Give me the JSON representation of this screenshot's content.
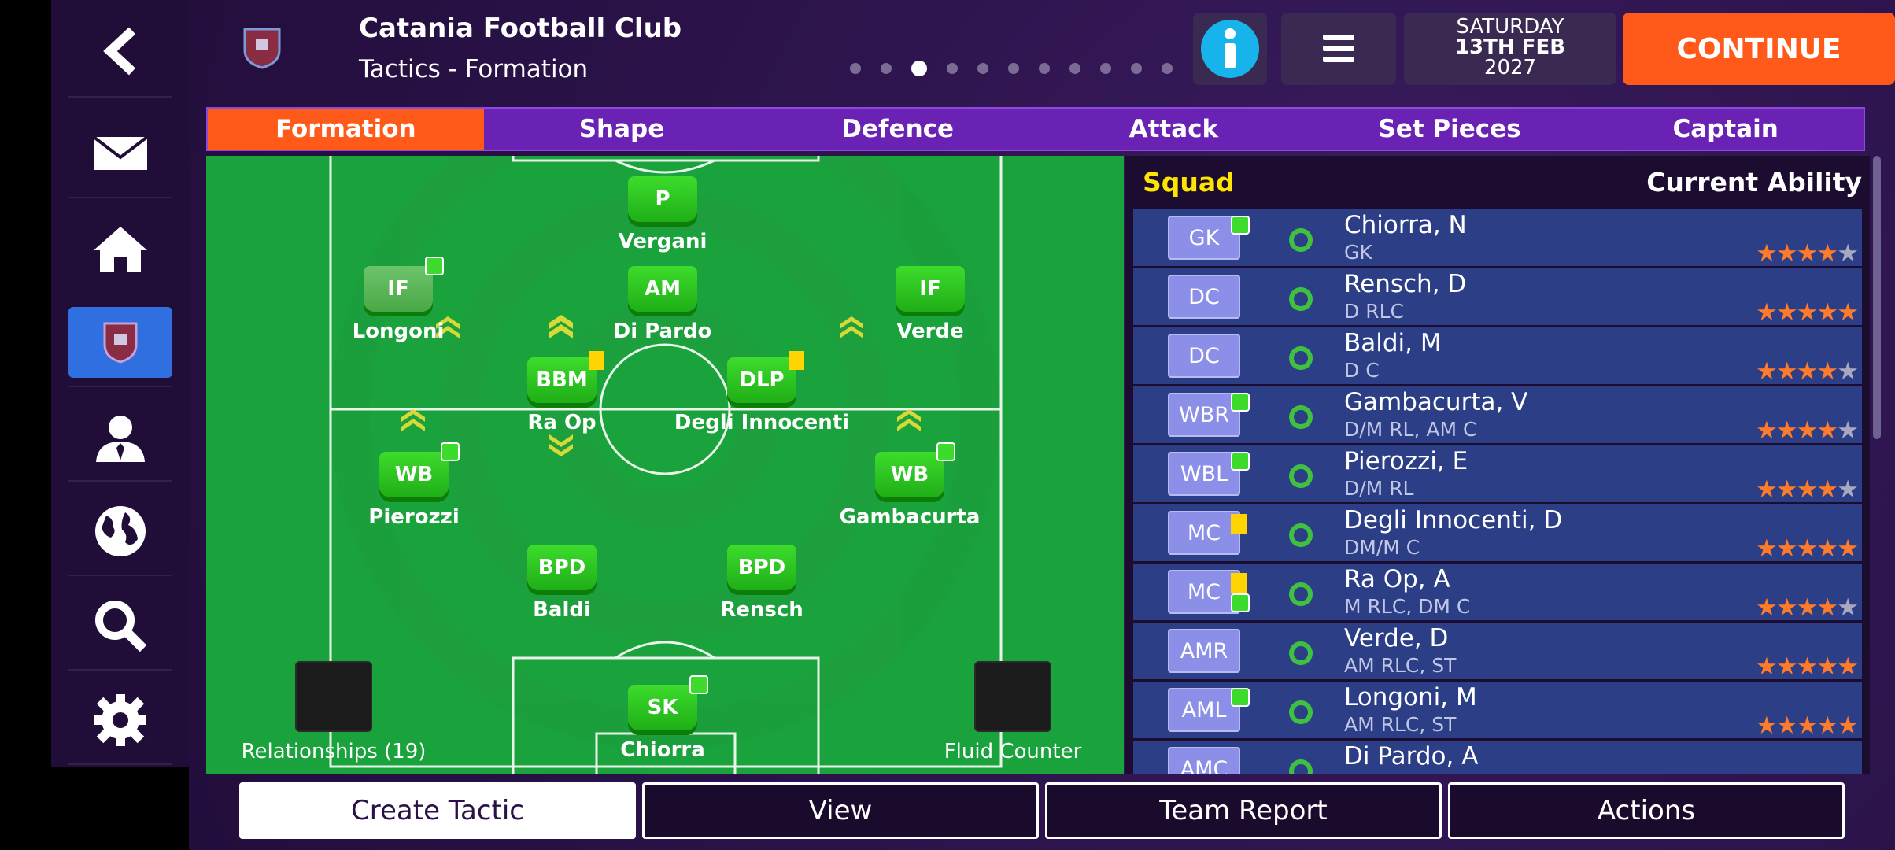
{
  "header": {
    "club_name": "Catania Football Club",
    "subtitle": "Tactics - Formation",
    "date_line1": "SATURDAY",
    "date_line2": "13TH FEB",
    "date_line3": "2027",
    "continue_label": "CONTINUE",
    "pager_total": 11,
    "pager_active": 3
  },
  "sidebar": {
    "icons": [
      "back-arrow-icon",
      "mail-icon",
      "home-icon",
      "club-crest-icon",
      "manager-icon",
      "globe-icon",
      "search-icon",
      "gear-icon"
    ],
    "active": "club-crest-icon"
  },
  "tabs": [
    {
      "label": "Formation"
    },
    {
      "label": "Shape"
    },
    {
      "label": "Defence"
    },
    {
      "label": "Attack"
    },
    {
      "label": "Set Pieces"
    },
    {
      "label": "Captain"
    }
  ],
  "pitch": {
    "players": [
      {
        "role": "P",
        "name": "Vergani"
      },
      {
        "role": "IF",
        "name": "Longoni"
      },
      {
        "role": "AM",
        "name": "Di Pardo"
      },
      {
        "role": "IF",
        "name": "Verde"
      },
      {
        "role": "BBM",
        "name": "Ra Op"
      },
      {
        "role": "DLP",
        "name": "Degli Innocenti"
      },
      {
        "role": "WB",
        "name": "Pierozzi"
      },
      {
        "role": "WB",
        "name": "Gambacurta"
      },
      {
        "role": "BPD",
        "name": "Baldi"
      },
      {
        "role": "BPD",
        "name": "Rensch"
      },
      {
        "role": "SK",
        "name": "Chiorra"
      }
    ],
    "relationships_label": "Relationships (19)",
    "mentality_label": "Fluid Counter"
  },
  "squad": {
    "title": "Squad",
    "ability_header": "Current Ability",
    "rows": [
      {
        "pos": "GK",
        "name": "Chiorra, N",
        "positions": "GK",
        "stars": "★★★★",
        "half": "★"
      },
      {
        "pos": "DC",
        "name": "Rensch, D",
        "positions": "D RLC",
        "stars": "★★★★★",
        "half": ""
      },
      {
        "pos": "DC",
        "name": "Baldi, M",
        "positions": "D C",
        "stars": "★★★★",
        "half": "★"
      },
      {
        "pos": "WBR",
        "name": "Gambacurta, V",
        "positions": "D/M RL, AM C",
        "stars": "★★★★",
        "half": "★"
      },
      {
        "pos": "WBL",
        "name": "Pierozzi, E",
        "positions": "D/M RL",
        "stars": "★★★★",
        "half": "★"
      },
      {
        "pos": "MC",
        "name": "Degli Innocenti, D",
        "positions": "DM/M C",
        "stars": "★★★★★",
        "half": ""
      },
      {
        "pos": "MC",
        "name": "Ra Op, A",
        "positions": "M RLC, DM C",
        "stars": "★★★★",
        "half": "★"
      },
      {
        "pos": "AMR",
        "name": "Verde, D",
        "positions": "AM RLC, ST",
        "stars": "★★★★★",
        "half": ""
      },
      {
        "pos": "AML",
        "name": "Longoni, M",
        "positions": "AM RLC, ST",
        "stars": "★★★★★",
        "half": ""
      },
      {
        "pos": "AMC",
        "name": "Di Pardo, A",
        "positions": "",
        "stars": "",
        "half": ""
      }
    ]
  },
  "bottom": {
    "create": "Create Tactic",
    "view": "View",
    "report": "Team Report",
    "actions": "Actions"
  },
  "colors": {
    "accent_orange": "#ff5a1a",
    "tab_purple": "#6a22b4",
    "pitch_green": "#1aa33c",
    "row_blue": "#2c3f86",
    "squad_yellow": "#ffe400"
  }
}
